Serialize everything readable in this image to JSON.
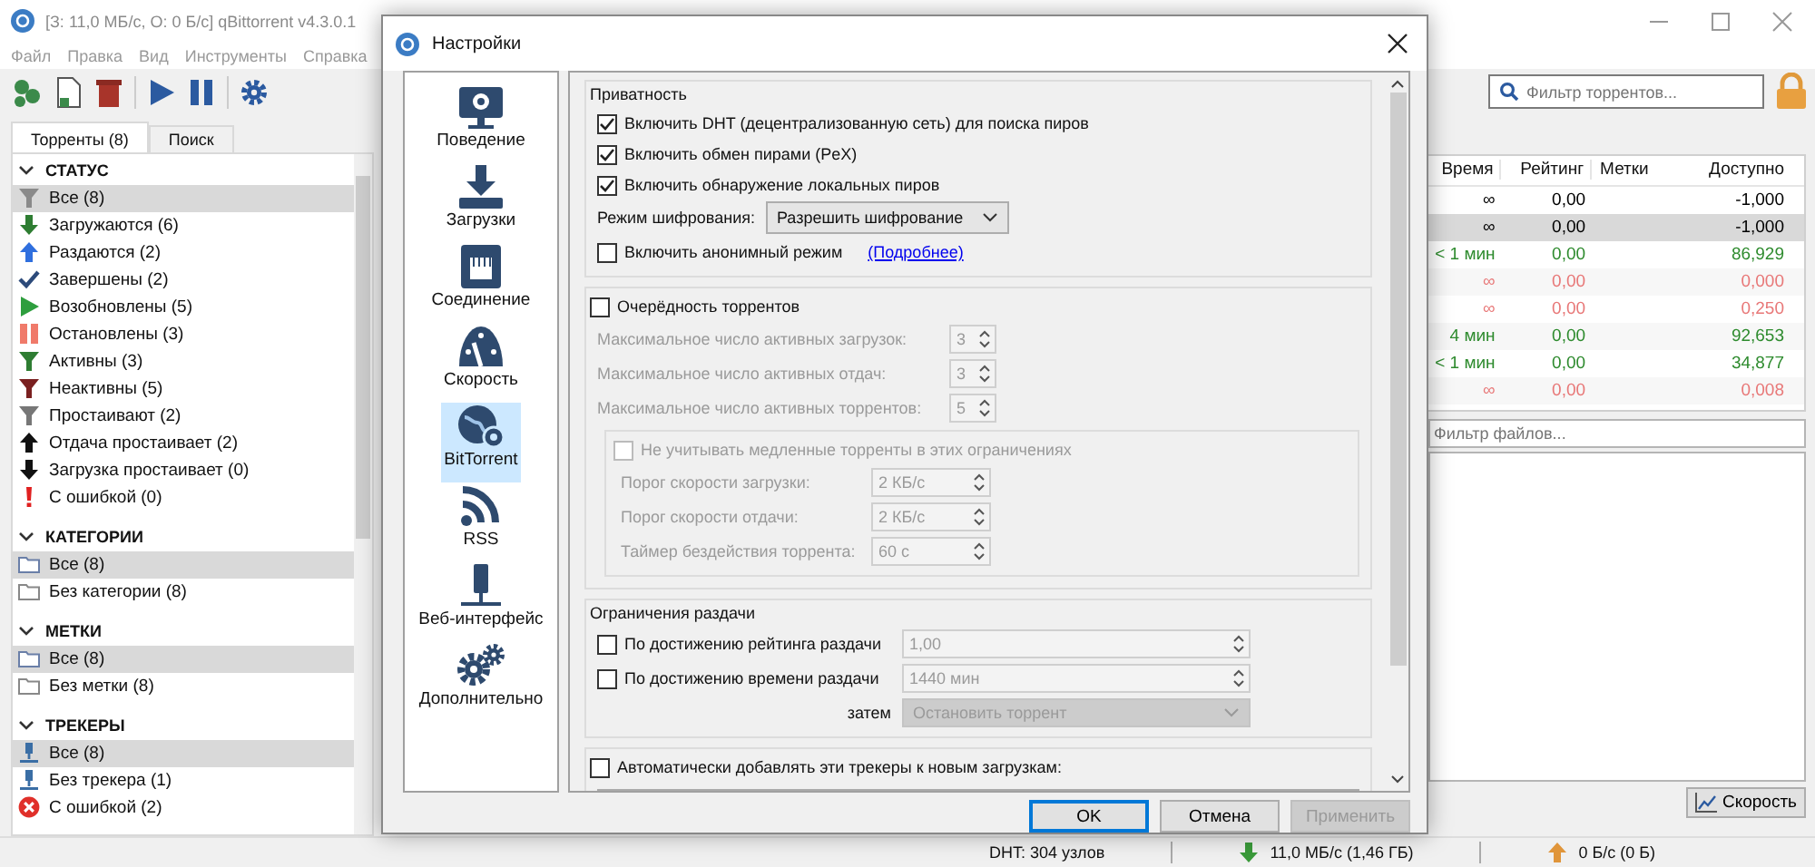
{
  "window": {
    "title": "[З: 11,0 МБ/с, О: 0 Б/с] qBittorrent v4.3.0.1"
  },
  "menu": [
    "Файл",
    "Правка",
    "Вид",
    "Инструменты",
    "Справка"
  ],
  "search": {
    "placeholder": "Фильтр торрентов..."
  },
  "sidebar": {
    "tabs": [
      {
        "label": "Торренты (8)",
        "selected": true
      },
      {
        "label": "Поиск",
        "selected": false
      }
    ],
    "sections": [
      {
        "title": "СТАТУС",
        "expanded": true,
        "items": [
          {
            "label": "Все (8)",
            "selected": true
          },
          {
            "label": "Загружаются (6)",
            "selected": false
          },
          {
            "label": "Раздаются (2)",
            "selected": false
          },
          {
            "label": "Завершены (2)",
            "selected": false
          },
          {
            "label": "Возобновлены (5)",
            "selected": false
          },
          {
            "label": "Остановлены (3)",
            "selected": false
          },
          {
            "label": "Активны (3)",
            "selected": false
          },
          {
            "label": "Неактивны (5)",
            "selected": false
          },
          {
            "label": "Простаивают (2)",
            "selected": false
          },
          {
            "label": "Отдача простаивает (2)",
            "selected": false
          },
          {
            "label": "Загрузка простаивает (0)",
            "selected": false
          },
          {
            "label": "С ошибкой (0)",
            "selected": false
          }
        ]
      },
      {
        "title": "КАТЕГОРИИ",
        "expanded": true,
        "items": [
          {
            "label": "Все (8)",
            "selected": true
          },
          {
            "label": "Без категории (8)",
            "selected": false
          }
        ]
      },
      {
        "title": "МЕТКИ",
        "expanded": true,
        "items": [
          {
            "label": "Все (8)",
            "selected": true
          },
          {
            "label": "Без метки (8)",
            "selected": false
          }
        ]
      },
      {
        "title": "ТРЕКЕРЫ",
        "expanded": true,
        "items": [
          {
            "label": "Все (8)",
            "selected": true
          },
          {
            "label": "Без трекера (1)",
            "selected": false
          },
          {
            "label": "С ошибкой (2)",
            "selected": false
          }
        ]
      }
    ]
  },
  "table": {
    "columns": [
      "Время",
      "Рейтинг",
      "Метки",
      "Доступно"
    ],
    "rows": [
      {
        "time": "∞",
        "rating": "0,00",
        "available": "-1,000",
        "color": "#000000",
        "selected": false
      },
      {
        "time": "∞",
        "rating": "0,00",
        "available": "-1,000",
        "color": "#000000",
        "selected": true
      },
      {
        "time": "< 1 мин",
        "rating": "0,00",
        "available": "86,929",
        "color": "#2e8b2e",
        "selected": false
      },
      {
        "time": "∞",
        "rating": "0,00",
        "available": "0,000",
        "color": "#e87878",
        "selected": false
      },
      {
        "time": "∞",
        "rating": "0,00",
        "available": "0,250",
        "color": "#e87878",
        "selected": false
      },
      {
        "time": "4 мин",
        "rating": "0,00",
        "available": "92,653",
        "color": "#2e8b2e",
        "selected": false
      },
      {
        "time": "< 1 мин",
        "rating": "0,00",
        "available": "34,877",
        "color": "#2e8b2e",
        "selected": false
      },
      {
        "time": "∞",
        "rating": "0,00",
        "available": "0,008",
        "color": "#e87878",
        "selected": false
      }
    ]
  },
  "files_filter": {
    "placeholder": "Фильтр файлов..."
  },
  "speed_button": "Скорость",
  "status_bar": {
    "dht": "DHT: 304 узлов",
    "download": "11,0 МБ/с (1,46 ГБ)",
    "upload": "0 Б/с (0 Б)"
  },
  "dialog": {
    "title": "Настройки",
    "nav": [
      {
        "label": "Поведение",
        "selected": false
      },
      {
        "label": "Загрузки",
        "selected": false
      },
      {
        "label": "Соединение",
        "selected": false
      },
      {
        "label": "Скорость",
        "selected": false
      },
      {
        "label": "BitTorrent",
        "selected": true
      },
      {
        "label": "RSS",
        "selected": false
      },
      {
        "label": "Веб-интерфейс",
        "selected": false
      },
      {
        "label": "Дополнительно",
        "selected": false
      }
    ],
    "privacy": {
      "title": "Приватность",
      "options": [
        {
          "label": "Включить DHT (децентрализованную сеть) для поиска пиров",
          "checked": true
        },
        {
          "label": "Включить обмен пирами (PeX)",
          "checked": true
        },
        {
          "label": "Включить обнаружение локальных пиров",
          "checked": true
        }
      ],
      "encryption": {
        "label": "Режим шифрования:",
        "value": "Разрешить шифрование"
      },
      "anonymous": {
        "label": "Включить анонимный режим",
        "checked": false,
        "link": "(Подробнее)"
      }
    },
    "queue": {
      "label": "Очерёдность торрентов",
      "checked": false,
      "limits": [
        {
          "label": "Максимальное число активных загрузок:",
          "value": "3",
          "disabled": true
        },
        {
          "label": "Максимальное число активных отдач:",
          "value": "3",
          "disabled": true
        },
        {
          "label": "Максимальное число активных торрентов:",
          "value": "5",
          "disabled": true
        }
      ],
      "slow": {
        "label": "Не учитывать медленные торренты в этих ограничениях",
        "checked": false,
        "disabled": true,
        "limits": [
          {
            "label": "Порог скорости загрузки:",
            "value": "2 КБ/с",
            "disabled": true
          },
          {
            "label": "Порог скорости отдачи:",
            "value": "2 КБ/с",
            "disabled": true
          },
          {
            "label": "Таймер бездействия торрента:",
            "value": "60 с",
            "disabled": true
          }
        ]
      }
    },
    "seeding": {
      "title": "Ограничения раздачи",
      "limits": [
        {
          "label": "По достижению рейтинга раздачи",
          "checked": false,
          "value": "1,00",
          "disabled": true
        },
        {
          "label": "По достижению времени раздачи",
          "checked": false,
          "value": "1440 мин",
          "disabled": true
        }
      ],
      "then": {
        "label": "затем",
        "value": "Остановить торрент",
        "disabled": true
      }
    },
    "trackers": {
      "label": "Автоматически добавлять эти трекеры к новым загрузкам:",
      "checked": false
    },
    "buttons": [
      {
        "label": "OK",
        "kind": "default"
      },
      {
        "label": "Отмена",
        "kind": "normal"
      },
      {
        "label": "Применить",
        "kind": "disabled"
      }
    ]
  }
}
